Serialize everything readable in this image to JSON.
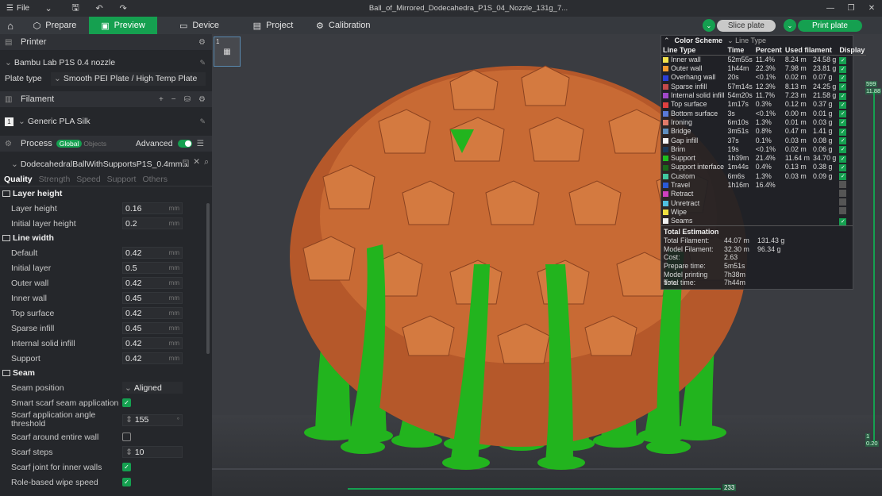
{
  "titlebar": {
    "file_label": "File",
    "title": "Ball_of_Mirrored_Dodecahedra_P1S_04_Nozzle_131g_7..."
  },
  "nav": {
    "tabs": [
      {
        "label": "Prepare"
      },
      {
        "label": "Preview"
      },
      {
        "label": "Device"
      },
      {
        "label": "Project"
      },
      {
        "label": "Calibration"
      }
    ],
    "slice_label": "Slice plate",
    "print_label": "Print plate"
  },
  "printer": {
    "header": "Printer",
    "name": "Bambu Lab P1S 0.4 nozzle",
    "plate_type_label": "Plate type",
    "plate_type_value": "Smooth PEI Plate / High Temp Plate"
  },
  "filament": {
    "header": "Filament",
    "index": "1",
    "name": "Generic PLA Silk"
  },
  "process": {
    "header": "Process",
    "global_label": "Global",
    "objects_label": "Objects",
    "advanced_label": "Advanced",
    "profile": "DodecahedralBallWithSupportsP1S_0.4mm...",
    "tabs": [
      "Quality",
      "Strength",
      "Speed",
      "Support",
      "Others"
    ]
  },
  "groups": {
    "layer_height": {
      "title": "Layer height",
      "params": [
        {
          "label": "Layer height",
          "value": "0.16",
          "unit": "mm"
        },
        {
          "label": "Initial layer height",
          "value": "0.2",
          "unit": "mm"
        }
      ]
    },
    "line_width": {
      "title": "Line width",
      "params": [
        {
          "label": "Default",
          "value": "0.42",
          "unit": "mm"
        },
        {
          "label": "Initial layer",
          "value": "0.5",
          "unit": "mm"
        },
        {
          "label": "Outer wall",
          "value": "0.42",
          "unit": "mm"
        },
        {
          "label": "Inner wall",
          "value": "0.45",
          "unit": "mm"
        },
        {
          "label": "Top surface",
          "value": "0.42",
          "unit": "mm"
        },
        {
          "label": "Sparse infill",
          "value": "0.45",
          "unit": "mm"
        },
        {
          "label": "Internal solid infill",
          "value": "0.42",
          "unit": "mm"
        },
        {
          "label": "Support",
          "value": "0.42",
          "unit": "mm"
        }
      ]
    },
    "seam": {
      "title": "Seam",
      "position_label": "Seam position",
      "position_value": "Aligned",
      "smart_scarf_label": "Smart scarf seam application",
      "scarf_angle_label": "Scarf application angle threshold",
      "scarf_angle_value": "155",
      "scarf_angle_unit": "°",
      "scarf_entire_label": "Scarf around entire wall",
      "scarf_steps_label": "Scarf steps",
      "scarf_steps_value": "10",
      "scarf_inner_label": "Scarf joint for inner walls",
      "role_wipe_label": "Role-based wipe speed"
    }
  },
  "legend": {
    "color_scheme_label": "Color Scheme",
    "mode": "Line Type",
    "headers": [
      "Line Type",
      "Time",
      "Percent",
      "Used filament",
      "",
      "Display"
    ],
    "rows": [
      {
        "name": "Inner wall",
        "color": "#f3e34c",
        "time": "52m55s",
        "pct": "11.4%",
        "len": "8.24 m",
        "g": "24.58 g",
        "on": true
      },
      {
        "name": "Outer wall",
        "color": "#f29b2d",
        "time": "1h44m",
        "pct": "22.3%",
        "len": "7.98 m",
        "g": "23.81 g",
        "on": true
      },
      {
        "name": "Overhang wall",
        "color": "#2b3fd6",
        "time": "20s",
        "pct": "<0.1%",
        "len": "0.02 m",
        "g": "0.07 g",
        "on": true
      },
      {
        "name": "Sparse infill",
        "color": "#c24a4a",
        "time": "57m14s",
        "pct": "12.3%",
        "len": "8.13 m",
        "g": "24.25 g",
        "on": true
      },
      {
        "name": "Internal solid infill",
        "color": "#a048c8",
        "time": "54m20s",
        "pct": "11.7%",
        "len": "7.23 m",
        "g": "21.58 g",
        "on": true
      },
      {
        "name": "Top surface",
        "color": "#e04040",
        "time": "1m17s",
        "pct": "0.3%",
        "len": "0.12 m",
        "g": "0.37 g",
        "on": true
      },
      {
        "name": "Bottom surface",
        "color": "#5a7ad8",
        "time": "3s",
        "pct": "<0.1%",
        "len": "0.00 m",
        "g": "0.01 g",
        "on": true
      },
      {
        "name": "Ironing",
        "color": "#e07a6a",
        "time": "6m10s",
        "pct": "1.3%",
        "len": "0.01 m",
        "g": "0.03 g",
        "on": true
      },
      {
        "name": "Bridge",
        "color": "#5f8fc0",
        "time": "3m51s",
        "pct": "0.8%",
        "len": "0.47 m",
        "g": "1.41 g",
        "on": true
      },
      {
        "name": "Gap infill",
        "color": "#f5f5f5",
        "time": "37s",
        "pct": "0.1%",
        "len": "0.03 m",
        "g": "0.08 g",
        "on": true
      },
      {
        "name": "Brim",
        "color": "#1a3a5a",
        "time": "19s",
        "pct": "<0.1%",
        "len": "0.02 m",
        "g": "0.06 g",
        "on": true
      },
      {
        "name": "Support",
        "color": "#1ec01e",
        "time": "1h39m",
        "pct": "21.4%",
        "len": "11.64 m",
        "g": "34.70 g",
        "on": true
      },
      {
        "name": "Support interface",
        "color": "#1a6a1a",
        "time": "1m44s",
        "pct": "0.4%",
        "len": "0.13 m",
        "g": "0.38 g",
        "on": true
      },
      {
        "name": "Custom",
        "color": "#40c8a0",
        "time": "6m6s",
        "pct": "1.3%",
        "len": "0.03 m",
        "g": "0.09 g",
        "on": true
      },
      {
        "name": "Travel",
        "color": "#2a5ad8",
        "time": "1h16m",
        "pct": "16.4%",
        "len": "",
        "g": "",
        "on": false
      },
      {
        "name": "Retract",
        "color": "#d040c0",
        "time": "",
        "pct": "",
        "len": "",
        "g": "",
        "on": false
      },
      {
        "name": "Unretract",
        "color": "#50c0e0",
        "time": "",
        "pct": "",
        "len": "",
        "g": "",
        "on": false
      },
      {
        "name": "Wipe",
        "color": "#f0e040",
        "time": "",
        "pct": "",
        "len": "",
        "g": "",
        "on": false
      },
      {
        "name": "Seams",
        "color": "#f0f0f0",
        "time": "",
        "pct": "",
        "len": "",
        "g": "",
        "on": true
      }
    ],
    "total": {
      "title": "Total Estimation",
      "rows": [
        {
          "k": "Total Filament:",
          "v1": "44.07 m",
          "v2": "131.43 g"
        },
        {
          "k": "Model Filament:",
          "v1": "32.30 m",
          "v2": "96.34 g"
        },
        {
          "k": "Cost:",
          "v1": "2.63",
          "v2": ""
        },
        {
          "k": "Prepare time:",
          "v1": "5m51s",
          "v2": ""
        },
        {
          "k": "Model printing time:",
          "v1": "7h38m",
          "v2": ""
        },
        {
          "k": "Total time:",
          "v1": "7h44m",
          "v2": ""
        }
      ]
    }
  },
  "sliders": {
    "v_top_a": "599",
    "v_top_b": "11.88",
    "v_bot_a": "1",
    "v_bot_b": "0.20",
    "h_value": "233"
  },
  "plate_thumb_num": "1"
}
